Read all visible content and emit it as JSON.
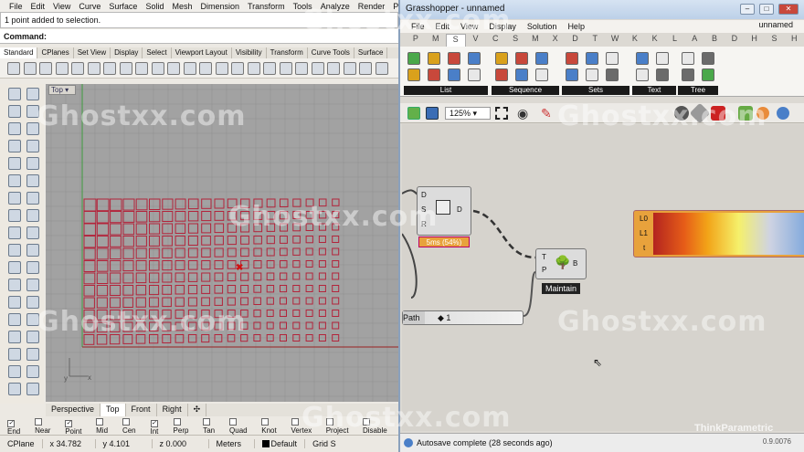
{
  "rhino": {
    "menu": [
      "File",
      "Edit",
      "View",
      "Curve",
      "Surface",
      "Solid",
      "Mesh",
      "Dimension",
      "Transform",
      "Tools",
      "Analyze",
      "Render",
      "Panels"
    ],
    "history": "1 point added to selection.",
    "command_label": "Command:",
    "toolbar_tabs": [
      {
        "label": "Standard",
        "active": true
      },
      {
        "label": "CPlanes",
        "active": false
      },
      {
        "label": "Set View",
        "active": false
      },
      {
        "label": "Display",
        "active": false
      },
      {
        "label": "Select",
        "active": false
      },
      {
        "label": "Viewport Layout",
        "active": false
      },
      {
        "label": "Visibility",
        "active": false
      },
      {
        "label": "Transform",
        "active": false
      },
      {
        "label": "Curve Tools",
        "active": false
      },
      {
        "label": "Surface",
        "active": false
      }
    ],
    "viewport_label": "Top",
    "axis_labels": {
      "x": "x",
      "y": "y"
    },
    "viewport_tabs": [
      {
        "label": "Perspective",
        "active": false
      },
      {
        "label": "Top",
        "active": true
      },
      {
        "label": "Front",
        "active": false
      },
      {
        "label": "Right",
        "active": false
      },
      {
        "label": "✣",
        "active": false
      }
    ],
    "osnaps": [
      {
        "label": "End",
        "checked": true
      },
      {
        "label": "Near",
        "checked": false
      },
      {
        "label": "Point",
        "checked": true
      },
      {
        "label": "Mid",
        "checked": false
      },
      {
        "label": "Cen",
        "checked": false
      },
      {
        "label": "Int",
        "checked": true
      },
      {
        "label": "Perp",
        "checked": false
      },
      {
        "label": "Tan",
        "checked": false
      },
      {
        "label": "Quad",
        "checked": false
      },
      {
        "label": "Knot",
        "checked": false
      },
      {
        "label": "Vertex",
        "checked": false
      },
      {
        "label": "Project",
        "checked": false
      },
      {
        "label": "Disable",
        "checked": false
      }
    ],
    "status": {
      "cplane": "CPlane",
      "x": "x 34.782",
      "y": "y 4.101",
      "z": "z 0.000",
      "units": "Meters",
      "layer": "Default",
      "grid_snap": "Grid S"
    },
    "grid": {
      "cols": 20,
      "rows": 12,
      "color": "#b3243b"
    }
  },
  "grasshopper": {
    "title": "Grasshopper - unnamed",
    "window_buttons": [
      "–",
      "□",
      "✕"
    ],
    "menu": [
      "File",
      "Edit",
      "View",
      "Display",
      "Solution",
      "Help"
    ],
    "document_name": "unnamed",
    "tab_letters": [
      "P",
      "M",
      "S",
      "V",
      "C",
      "S",
      "M",
      "X",
      "D",
      "T",
      "W",
      "K",
      "K",
      "L",
      "A",
      "B",
      "D",
      "H",
      "S",
      "H"
    ],
    "active_letter_index": 2,
    "ribbon_groups": [
      "List",
      "Sequence",
      "Sets",
      "Text",
      "Tree"
    ],
    "zoom": "125%",
    "nodes": {
      "cluster": {
        "inputs": [
          "D",
          "S",
          "R"
        ],
        "output": "D",
        "timing": "5ms (54%)"
      },
      "maintain": {
        "inputs": [
          "T",
          "P"
        ],
        "output": "B",
        "label": "Maintain"
      },
      "gradient": {
        "inputs": [
          "L0",
          "L1",
          "t"
        ]
      },
      "path_param": {
        "label": "Path",
        "value": "1"
      }
    },
    "status": "Autosave complete (28 seconds ago)",
    "version": "0.9.0076"
  },
  "watermarks": [
    "Ghostxx.com",
    "Ghostxx.com",
    "Ghostxx.com",
    "Ghostxx.com",
    "Ghostxx.com",
    "Ghostxx.com",
    "Ghostxx.com",
    "ThinkParametric"
  ],
  "colors": {
    "accent": "#b3243b",
    "gh_title": "#bcd0e8"
  }
}
